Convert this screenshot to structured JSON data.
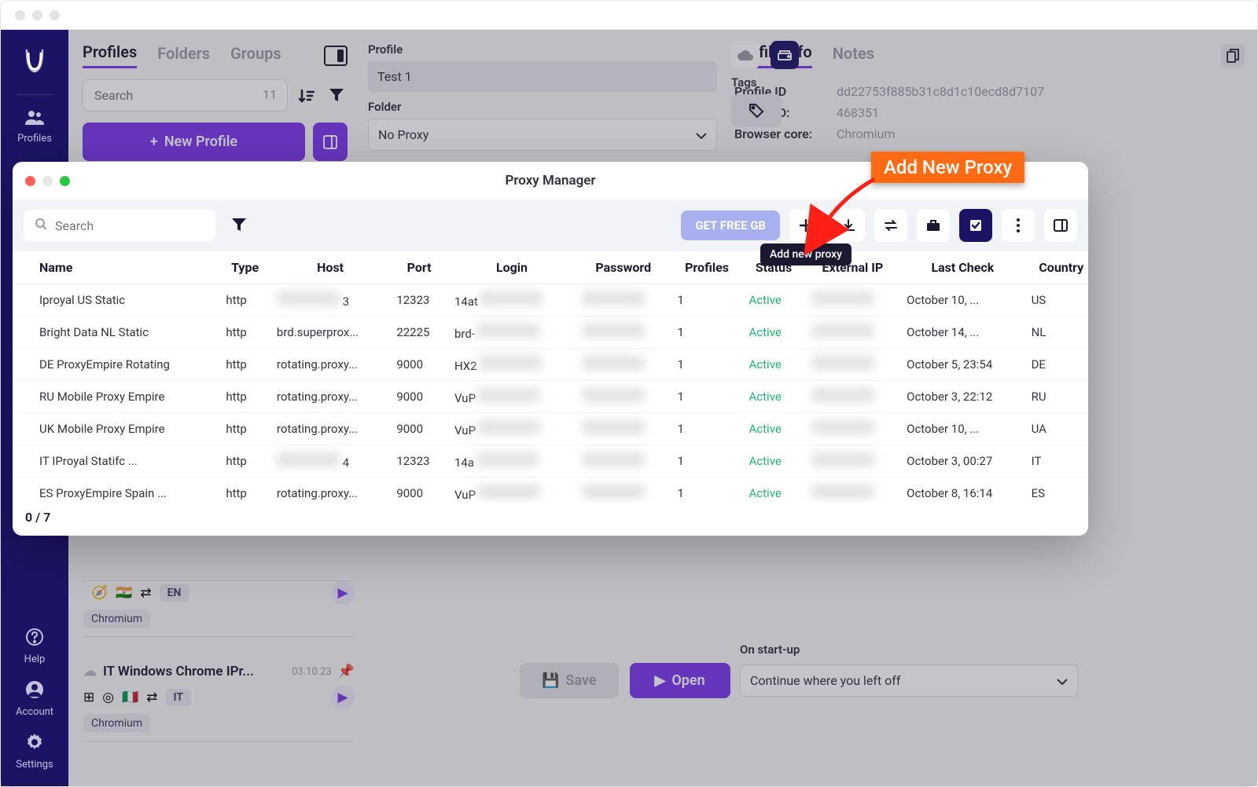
{
  "nav": {
    "items": [
      {
        "label": "Profiles"
      },
      {
        "label": "Help"
      },
      {
        "label": "Account"
      },
      {
        "label": "Settings"
      }
    ]
  },
  "col1": {
    "tabs": [
      {
        "label": "Profiles"
      },
      {
        "label": "Folders"
      },
      {
        "label": "Groups"
      }
    ],
    "search_placeholder": "Search",
    "search_count": "11",
    "new_profile": "New Profile",
    "profItems": [
      {
        "name": "",
        "date": "",
        "lang": "EN",
        "browser": "Chromium"
      },
      {
        "name": "IT Windows Chrome IPr...",
        "date": "03.10.23",
        "lang": "IT",
        "browser": "Chromium"
      }
    ]
  },
  "col2": {
    "profile_label": "Profile",
    "profile_value": "Test 1",
    "folder_label": "Folder",
    "folder_value": "No Proxy",
    "tags_label": "Tags"
  },
  "col3": {
    "tabs": [
      {
        "label": "Profile info"
      },
      {
        "label": "Notes"
      }
    ],
    "rows": [
      {
        "k": "Profile ID",
        "v": "dd22753f885b31c8d1c10ecd8d7107"
      },
      {
        "k": "Config ID:",
        "v": "468351"
      },
      {
        "k": "Browser core:",
        "v": "Chromium"
      }
    ],
    "startup_label": "On start-up",
    "startup_value": "Continue where you left off"
  },
  "buttons": {
    "save": "Save",
    "open": "Open"
  },
  "modal": {
    "title": "Proxy Manager",
    "search_placeholder": "Search",
    "get_free": "GET FREE GB",
    "tooltip": "Add new proxy",
    "headers": [
      "Name",
      "Type",
      "Host",
      "Port",
      "Login",
      "Password",
      "Profiles",
      "Status",
      "External IP",
      "Last Check",
      "Country"
    ],
    "rows": [
      {
        "name": "Iproyal US Static",
        "type": "http",
        "host": "3",
        "port": "12323",
        "login": "14at",
        "pwd": "",
        "profiles": "1",
        "status": "Active",
        "ip": "",
        "last": "October 10, ...",
        "country": "US"
      },
      {
        "name": "Bright Data NL Static",
        "type": "http",
        "host": "brd.superprox...",
        "port": "22225",
        "login": "brd-",
        "pwd": "",
        "profiles": "1",
        "status": "Active",
        "ip": "",
        "last": "October 14, ...",
        "country": "NL"
      },
      {
        "name": "DE ProxyEmpire Rotating",
        "type": "http",
        "host": "rotating.proxy...",
        "port": "9000",
        "login": "HX2",
        "pwd": "",
        "profiles": "1",
        "status": "Active",
        "ip": "",
        "last": "October 5, 23:54",
        "country": "DE"
      },
      {
        "name": "RU Mobile Proxy Empire",
        "type": "http",
        "host": "rotating.proxy...",
        "port": "9000",
        "login": "VuP",
        "pwd": "",
        "profiles": "1",
        "status": "Active",
        "ip": "",
        "last": "October 3, 22:12",
        "country": "RU"
      },
      {
        "name": "UK Mobile Proxy Empire",
        "type": "http",
        "host": "rotating.proxy...",
        "port": "9000",
        "login": "VuP",
        "pwd": "",
        "profiles": "1",
        "status": "Active",
        "ip": "",
        "last": "October 10, ...",
        "country": "UA"
      },
      {
        "name": "IT IProyal Statifc ...",
        "type": "http",
        "host": "4",
        "port": "12323",
        "login": "14a",
        "pwd": "",
        "profiles": "1",
        "status": "Active",
        "ip": "",
        "last": "October 3, 00:27",
        "country": "IT"
      },
      {
        "name": "ES ProxyEmpire Spain ...",
        "type": "http",
        "host": "rotating.proxy...",
        "port": "9000",
        "login": "VuP",
        "pwd": "",
        "profiles": "1",
        "status": "Active",
        "ip": "",
        "last": "October 8, 16:14",
        "country": "ES"
      }
    ],
    "footer": "0 / 7"
  },
  "callout": "Add New Proxy"
}
